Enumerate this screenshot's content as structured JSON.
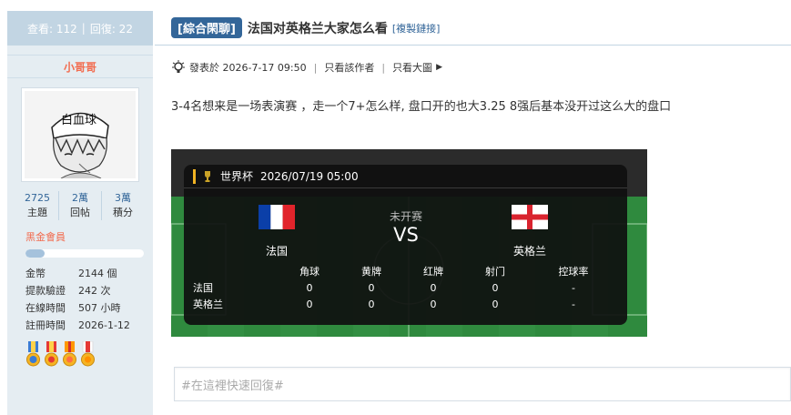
{
  "sidebar": {
    "views_text": "查看: 112",
    "replies_text": "回復: 22",
    "author": "小哥哥",
    "counts": [
      {
        "num": "2725",
        "label": "主題"
      },
      {
        "num": "2萬",
        "label": "回帖"
      },
      {
        "num": "3萬",
        "label": "積分"
      }
    ],
    "member_level": "黑金會員",
    "level_progress": 0.16,
    "info": [
      {
        "k": "金幣",
        "v": "2144 個"
      },
      {
        "k": "提款驗證",
        "v": "242 次"
      },
      {
        "k": "在線時間",
        "v": "507 小時"
      },
      {
        "k": "註冊時間",
        "v": "2026-1-12"
      }
    ],
    "avatar_text": "白血球",
    "medal_icons": [
      "medal-blue-icon",
      "medal-red-icon",
      "medal-orange-icon",
      "medal-red-white-icon"
    ]
  },
  "thread": {
    "category": "[綜合閑聊]",
    "title": "法国对英格兰大家怎么看",
    "copy_link": "[複製鏈接]",
    "posted": "發表於 2026-7-17 09:50",
    "only_author": "只看該作者",
    "only_images": "只看大圖",
    "body": "3-4名想来是一场表演赛 ，走一个7+怎么样, 盘口开的也大3.25  8强后基本没开过这么大的盘口"
  },
  "match": {
    "competition": "世界杯",
    "datetime": "2026/07/19 05:00",
    "status": "未开赛",
    "vs": "VS",
    "home": "法国",
    "away": "英格兰",
    "stat_headers": [
      "角球",
      "黄牌",
      "红牌",
      "射门",
      "控球率"
    ],
    "rows": [
      {
        "team": "法国",
        "values": [
          "0",
          "0",
          "0",
          "0",
          "-"
        ]
      },
      {
        "team": "英格兰",
        "values": [
          "0",
          "0",
          "0",
          "0",
          "-"
        ]
      }
    ],
    "accent_color": "#f0b323"
  },
  "reply": {
    "placeholder": "#在這裡快速回復#"
  }
}
